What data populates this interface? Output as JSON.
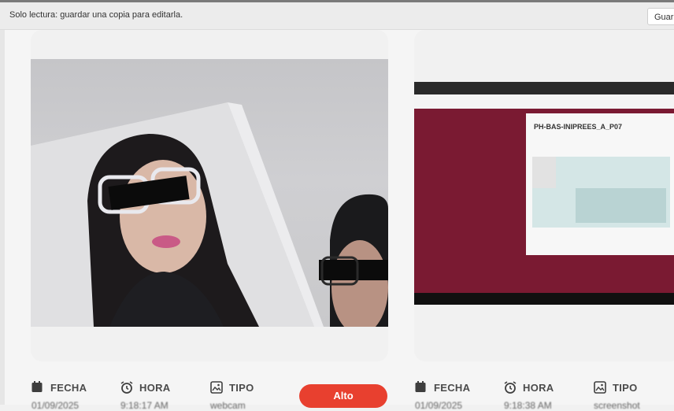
{
  "banner": {
    "readonly_text": "Solo lectura: guardar una copia para editarla.",
    "save_label": "Guar"
  },
  "screenshot": {
    "window_label": "PH-BAS-INIPREES_A_P07"
  },
  "cards": [
    {
      "fecha_label": "FECHA",
      "hora_label": "HORA",
      "tipo_label": "TIPO",
      "fecha_value": "01/09/2025",
      "hora_value": "9:18:17 AM",
      "tipo_value": "webcam",
      "risk_badge": "Alto"
    },
    {
      "fecha_label": "FECHA",
      "hora_label": "HORA",
      "tipo_label": "TIPO",
      "fecha_value": "01/09/2025",
      "hora_value": "9:18:38 AM",
      "tipo_value": "screenshot"
    }
  ],
  "colors": {
    "badge": "#e8402f",
    "screen_bg": "#7a1a32"
  }
}
